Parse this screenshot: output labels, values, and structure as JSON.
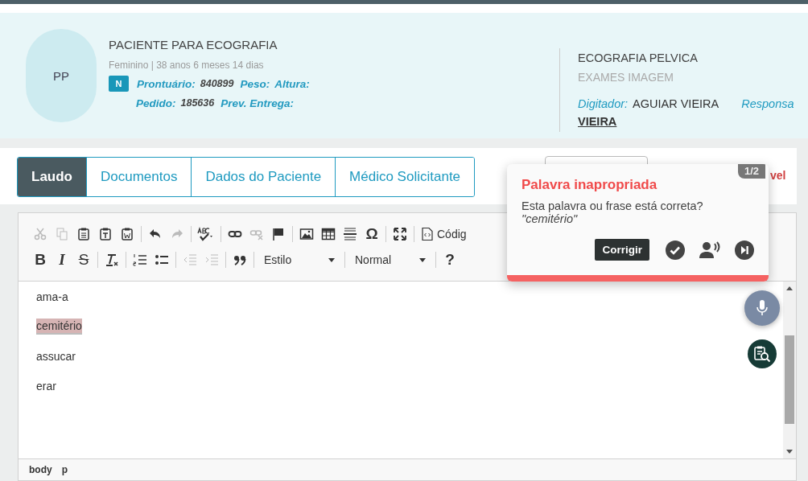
{
  "patient": {
    "initials": "PP",
    "name": "PACIENTE PARA ECOGRAFIA",
    "details": "Feminino | 38 anos 6 meses 14 dias",
    "badge": "N",
    "field_rows": [
      [
        {
          "label": "Prontuário:",
          "value": "840899"
        },
        {
          "label": "Peso:"
        },
        {
          "label": "Altura:"
        }
      ],
      [
        {
          "label": "Pedido:",
          "value": "185636"
        },
        {
          "label": "Prev. Entrega:"
        }
      ]
    ]
  },
  "exam": {
    "title": "ECOGRAFIA PELVICA",
    "category": "EXAMES IMAGEM",
    "typist_label": "Digitador:",
    "typist": "AGUIAR VIEIRA",
    "responsible_label": "Responsa",
    "responsible": "VIEIRA"
  },
  "tabs": [
    {
      "label": "Laudo",
      "selected": true
    },
    {
      "label": "Documentos",
      "selected": false
    },
    {
      "label": "Dados do Paciente",
      "selected": false
    },
    {
      "label": "Médico Solicitante",
      "selected": false
    }
  ],
  "tab_bar_right_text": "vel",
  "toolbar": {
    "row_1": [
      {
        "kind": "cut",
        "disabled": true
      },
      {
        "kind": "copy",
        "disabled": true
      },
      {
        "kind": "paste",
        "disabled": false
      },
      {
        "kind": "pastetext",
        "disabled": false
      },
      {
        "kind": "pasteword",
        "disabled": false
      },
      {
        "kind": "sep"
      },
      {
        "kind": "undo",
        "disabled": false
      },
      {
        "kind": "redo",
        "disabled": true
      },
      {
        "kind": "sep"
      },
      {
        "kind": "spell",
        "disabled": false
      },
      {
        "kind": "sep"
      },
      {
        "kind": "link",
        "disabled": false
      },
      {
        "kind": "unlink",
        "disabled": true
      },
      {
        "kind": "anchor",
        "disabled": false
      },
      {
        "kind": "sep"
      },
      {
        "kind": "image",
        "disabled": false
      },
      {
        "kind": "table",
        "disabled": false
      },
      {
        "kind": "hrule",
        "disabled": false
      },
      {
        "kind": "char",
        "text": "Ω",
        "disabled": false
      },
      {
        "kind": "sep"
      },
      {
        "kind": "maximize",
        "disabled": false
      },
      {
        "kind": "sep"
      },
      {
        "kind": "source",
        "text": "Códig",
        "disabled": false
      }
    ],
    "row_2": [
      {
        "kind": "bold",
        "text": "B",
        "disabled": false
      },
      {
        "kind": "italic",
        "text": "I",
        "disabled": false
      },
      {
        "kind": "strike",
        "text": "S",
        "disabled": false
      },
      {
        "kind": "sep"
      },
      {
        "kind": "clear",
        "disabled": false
      },
      {
        "kind": "sep"
      },
      {
        "kind": "ol",
        "disabled": false
      },
      {
        "kind": "ul",
        "disabled": false
      },
      {
        "kind": "sep"
      },
      {
        "kind": "outdent",
        "disabled": true
      },
      {
        "kind": "indent",
        "disabled": true
      },
      {
        "kind": "sep"
      },
      {
        "kind": "quote",
        "disabled": false
      },
      {
        "kind": "sep"
      },
      {
        "kind": "dropdown",
        "text": "Estilo",
        "disabled": false
      },
      {
        "kind": "sep"
      },
      {
        "kind": "dropdown",
        "text": "Normal",
        "disabled": false
      },
      {
        "kind": "sep"
      },
      {
        "kind": "char",
        "text": "?",
        "disabled": false
      }
    ]
  },
  "paragraphs": [
    {
      "text": "ama-a",
      "flagged": false
    },
    {
      "text": "cemitério",
      "flagged": true
    },
    {
      "text": "assucar",
      "flagged": false
    },
    {
      "text": "erar",
      "flagged": false
    }
  ],
  "status_path": [
    "body",
    "p"
  ],
  "popup": {
    "counter": "1/2",
    "title": "Palavra inapropriada",
    "message": "Esta palavra ou frase está correta?",
    "word": "\"cemitério\"",
    "button": "Corrigir"
  }
}
